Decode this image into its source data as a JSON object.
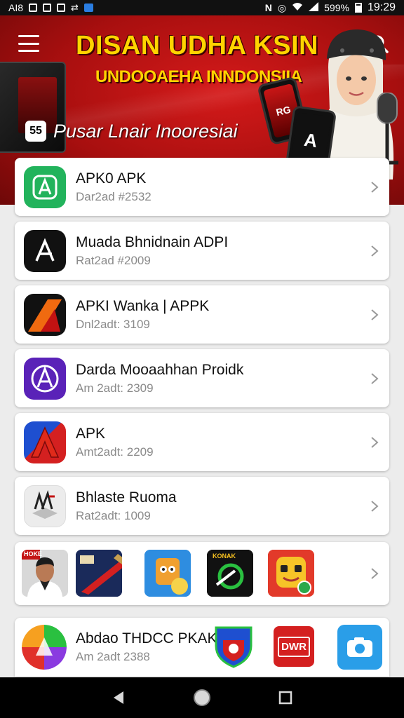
{
  "status_bar": {
    "left_text": "AI8",
    "battery_text": "599%",
    "time": "19:29",
    "icons": [
      "box-icon",
      "box-icon",
      "box-icon",
      "link-icon",
      "app-icon",
      "nfc-icon",
      "vibrate-icon",
      "wifi-icon",
      "signal-icon",
      "battery-icon"
    ]
  },
  "hero": {
    "title": "DISAN UDHA KSIN",
    "subtitle": "UNDOOAEHA INNDONSIIA",
    "tagline": "Pusar Lnair Inooresiai",
    "tagline_badge": "55",
    "phone_glyph": "A",
    "phone_glyph_small": "RG",
    "colors": {
      "background": "#c41414",
      "title": "#ffd400"
    }
  },
  "apps": [
    {
      "title": "APK0 APK",
      "subtitle": "Dar2ad #2532",
      "icon": "green-app-icon",
      "color": "#22b35c"
    },
    {
      "title": "Muada Bhnidnain ADPI",
      "subtitle": "Rat2ad #2009",
      "icon": "black-app-icon",
      "color": "#111111"
    },
    {
      "title": "APKI Wanka | APPK",
      "subtitle": "Dnl2adt: 3109",
      "icon": "orange-app-icon",
      "color": "#f06a10"
    },
    {
      "title": "Darda Mooaahhan Proidk",
      "subtitle": "Am 2adt: 2309",
      "icon": "purple-app-icon",
      "color": "#5a22b8"
    },
    {
      "title": "APK",
      "subtitle": "Amt2adt: 2209",
      "icon": "red-blue-app-icon",
      "color": "#d42020"
    },
    {
      "title": "Bhlaste Ruoma",
      "subtitle": "Rat2adt: 1009",
      "icon": "grey-app-icon",
      "color": "#e2e2e2"
    }
  ],
  "thumbnail_row": [
    {
      "icon": "person-thumbnail",
      "badge": "HOKE"
    },
    {
      "icon": "knife-thumbnail"
    },
    {
      "icon": "cartoon-thumbnail"
    },
    {
      "icon": "swoosh-thumbnail",
      "badge": "KONAK"
    },
    {
      "icon": "emoji-face-thumbnail"
    }
  ],
  "last_item": {
    "title": "Abdao THDCC PKAK",
    "subtitle": "Am 2adt 2388",
    "icon": "rainbow-app-icon",
    "extra_icons": [
      {
        "icon": "shield-icon"
      },
      {
        "icon": "red-logo-icon",
        "label": "DWR"
      },
      {
        "icon": "camera-icon"
      }
    ]
  },
  "nav": {
    "buttons": [
      "back-icon",
      "home-icon",
      "recents-icon"
    ]
  }
}
